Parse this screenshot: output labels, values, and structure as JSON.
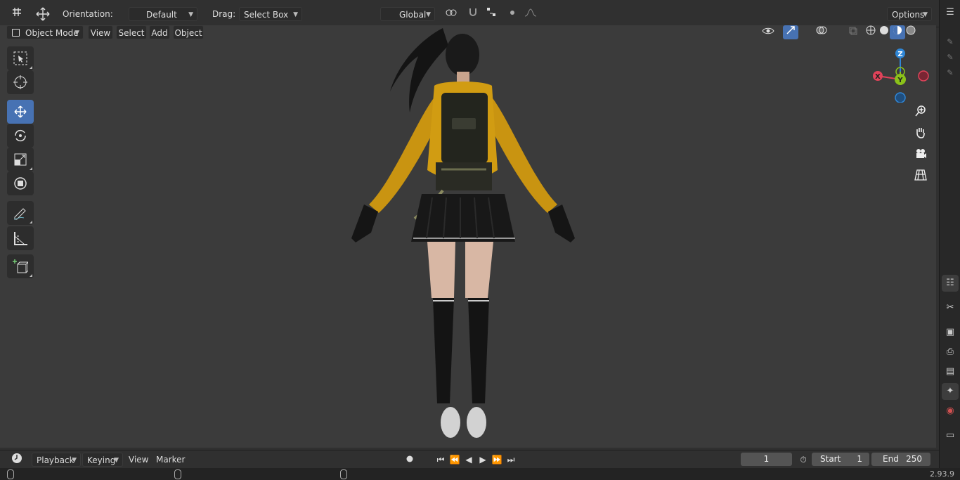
{
  "header": {
    "orientation_label": "Orientation:",
    "orientation_value": "Default",
    "drag_label": "Drag:",
    "drag_value": "Select Box",
    "transform_space": "Global",
    "options_label": "Options"
  },
  "viewport_header": {
    "mode": "Object Mode",
    "menus": [
      "View",
      "Select",
      "Add",
      "Object"
    ]
  },
  "toolbar": {
    "tools": [
      "select-box",
      "cursor",
      "move",
      "rotate",
      "scale",
      "transform",
      "annotate",
      "measure",
      "add-cube"
    ],
    "active": "move"
  },
  "gizmo": {
    "z": "Z",
    "y": "Y",
    "x": "X"
  },
  "timeline": {
    "menus": [
      "Playback",
      "Keying",
      "View",
      "Marker"
    ],
    "current_frame": "1",
    "start_label": "Start",
    "start_value": "1",
    "end_label": "End",
    "end_value": "250"
  },
  "status": {
    "version": "2.93.9"
  },
  "colors": {
    "accent": "#4772b3",
    "viewport_bg": "#3b3b3b",
    "axis_x": "#e0435a",
    "axis_y": "#8bc21a",
    "axis_z": "#2f86d6"
  }
}
